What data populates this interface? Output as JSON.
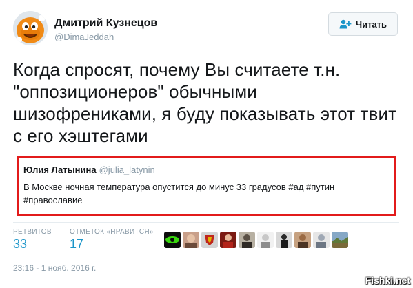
{
  "author": {
    "name": "Дмитрий Кузнецов",
    "handle": "@DimaJeddah"
  },
  "follow_button": {
    "label": "Читать",
    "icon": "add-user-icon"
  },
  "tweet": {
    "text": "Когда спросят, почему Вы считаете т.н. \"оппозиционеров\" обычными шизофрениками, я буду показывать этот твит с его хэштегами"
  },
  "quoted_tweet": {
    "name": "Юлия Латынина",
    "handle": "@julia_latynin",
    "text": "В Москве ночная температура опустится до минус 33 градусов #ад #путин #православие",
    "highlight_color": "#e21b1b"
  },
  "stats": {
    "retweets_label": "РЕТВИТОВ",
    "retweets_value": "33",
    "likes_label": "ОТМЕТОК «НРАВИТСЯ»",
    "likes_value": "17"
  },
  "likers": [
    {
      "icon": "green-eye-avatar"
    },
    {
      "icon": "person-avatar"
    },
    {
      "icon": "coat-of-arms-avatar"
    },
    {
      "icon": "red-figure-avatar"
    },
    {
      "icon": "person-avatar"
    },
    {
      "icon": "person-avatar"
    },
    {
      "icon": "dark-figure-avatar"
    },
    {
      "icon": "person-avatar"
    },
    {
      "icon": "person-avatar"
    },
    {
      "icon": "landscape-avatar"
    }
  ],
  "timestamp": "23:16 - 1 нояб. 2016 г.",
  "watermark": "Fishki.net",
  "colors": {
    "link_blue": "#1b95c9",
    "muted": "#8899a6",
    "text": "#14171a",
    "quote_border": "#e21b1b"
  }
}
